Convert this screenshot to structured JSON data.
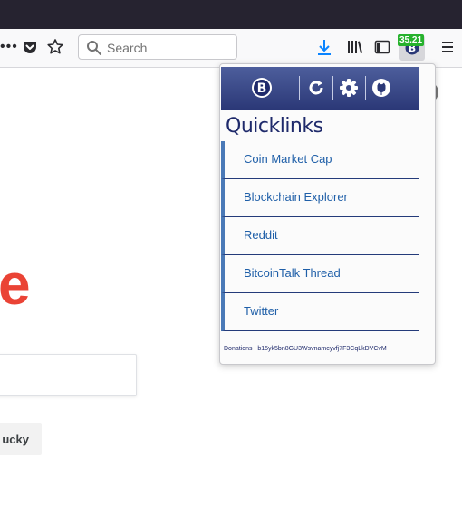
{
  "toolbar": {
    "overflow_glyph": "•••",
    "search_placeholder": "Search",
    "extension_badge": "35.21",
    "icons": [
      "overflow-icon",
      "pocket-icon",
      "bookmark-star-icon",
      "search-icon",
      "download-icon",
      "library-icon",
      "sidebar-icon",
      "bitcoin-extension-icon",
      "menu-icon"
    ]
  },
  "page": {
    "logo_fragment": "e",
    "lucky_button": "ucky"
  },
  "popup": {
    "title": "Quicklinks",
    "header_icons": [
      "bitcoin-logo-icon",
      "refresh-icon",
      "settings-icon",
      "github-icon"
    ],
    "links": [
      {
        "label": "Coin Market Cap"
      },
      {
        "label": "Blockchain Explorer"
      },
      {
        "label": "Reddit"
      },
      {
        "label": "BitcoinTalk Thread"
      },
      {
        "label": "Twitter"
      }
    ],
    "donation": "Donations : b15yk5bn8GU3Wsvnamcyvfj7F3CqLkDVCvM"
  },
  "colors": {
    "titlebar": "#262330",
    "popup_header": "#2b3877",
    "link_accent": "#4a79b7",
    "link_text": "#1f5fa8",
    "badge": "#27b22d",
    "logo_red": "#ea4335"
  }
}
